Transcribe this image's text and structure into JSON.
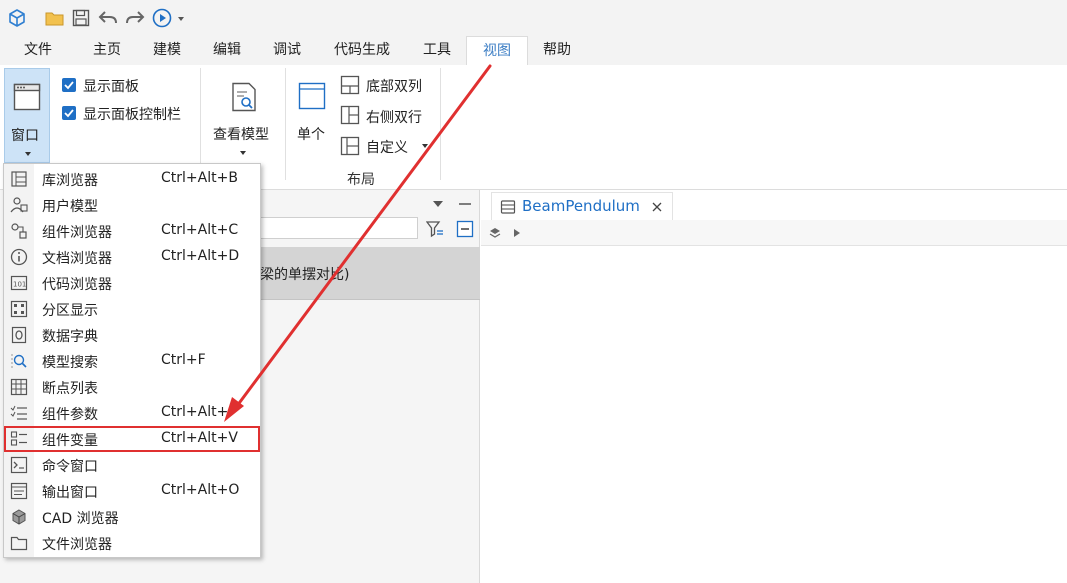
{
  "menu_tabs": [
    "文件",
    "主页",
    "建模",
    "编辑",
    "调试",
    "代码生成",
    "工具",
    "视图",
    "帮助"
  ],
  "active_tab": "视图",
  "ribbon": {
    "window_button": "窗口",
    "show_panel": "显示面板",
    "show_panel_controlbar": "显示面板控制栏",
    "view_model": "查看模型",
    "single": "单个",
    "bottom_two_cols": "底部双列",
    "right_two_rows": "右侧双行",
    "custom": "自定义",
    "layout_group": "布局"
  },
  "left_panel": {
    "tree_item_partial": "梁的单摆对比)"
  },
  "editor": {
    "doc_tab": "BeamPendulum"
  },
  "dropdown_items": [
    {
      "label": "库浏览器",
      "shortcut": "Ctrl+Alt+B",
      "icon": "library-browser-icon"
    },
    {
      "label": "用户模型",
      "shortcut": "",
      "icon": "user-model-icon"
    },
    {
      "label": "组件浏览器",
      "shortcut": "Ctrl+Alt+C",
      "icon": "component-browser-icon"
    },
    {
      "label": "文档浏览器",
      "shortcut": "Ctrl+Alt+D",
      "icon": "info-icon"
    },
    {
      "label": "代码浏览器",
      "shortcut": "",
      "icon": "code-browser-icon"
    },
    {
      "label": "分区显示",
      "shortcut": "",
      "icon": "partition-icon"
    },
    {
      "label": "数据字典",
      "shortcut": "",
      "icon": "data-dictionary-icon"
    },
    {
      "label": "模型搜索",
      "shortcut": "Ctrl+F",
      "icon": "model-search-icon"
    },
    {
      "label": "断点列表",
      "shortcut": "",
      "icon": "breakpoint-list-icon"
    },
    {
      "label": "组件参数",
      "shortcut": "Ctrl+Alt+P",
      "icon": "component-params-icon"
    },
    {
      "label": "组件变量",
      "shortcut": "Ctrl+Alt+V",
      "icon": "component-vars-icon"
    },
    {
      "label": "命令窗口",
      "shortcut": "",
      "icon": "command-window-icon"
    },
    {
      "label": "输出窗口",
      "shortcut": "Ctrl+Alt+O",
      "icon": "output-window-icon"
    },
    {
      "label": "CAD 浏览器",
      "shortcut": "",
      "icon": "cad-browser-icon"
    },
    {
      "label": "文件浏览器",
      "shortcut": "",
      "icon": "file-browser-icon"
    }
  ],
  "highlighted_item": "组件变量",
  "colors": {
    "accent": "#3b7dc4",
    "check": "#1f6fc5",
    "highlight_box": "#e03030",
    "arrow": "#e03030"
  }
}
